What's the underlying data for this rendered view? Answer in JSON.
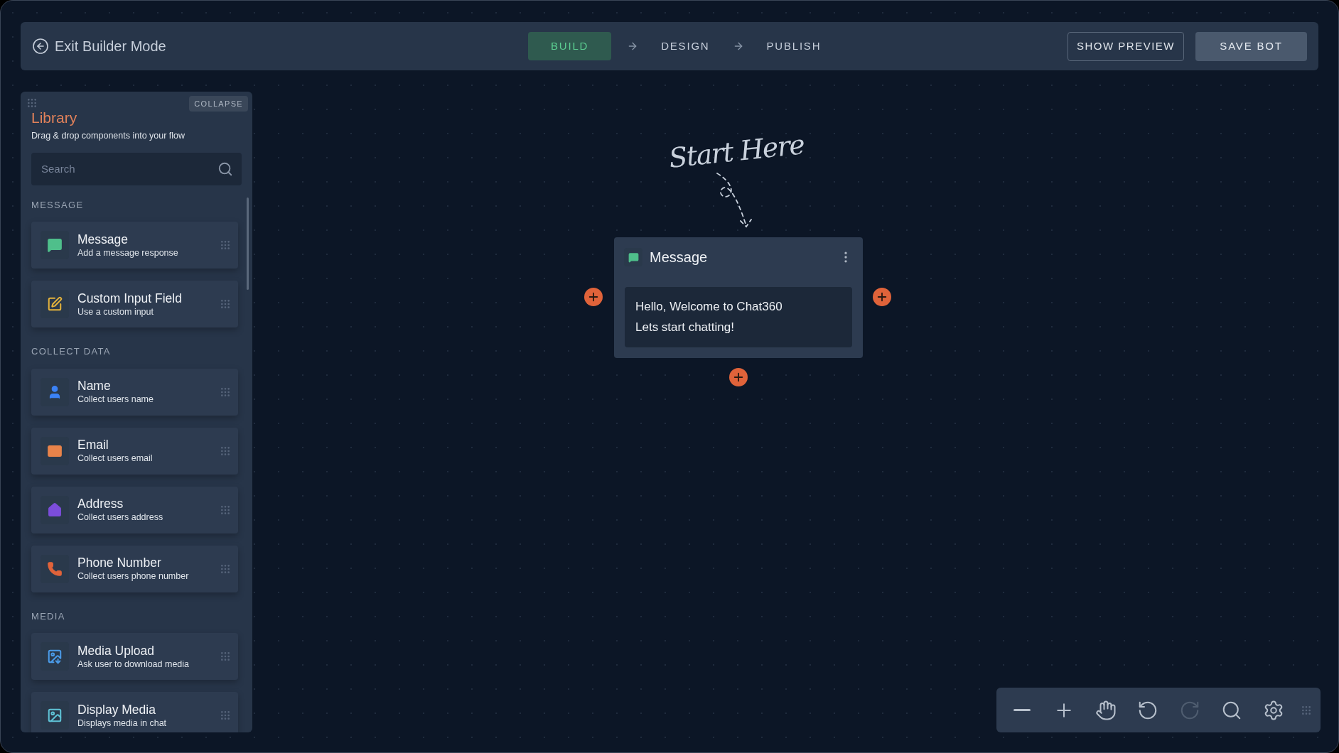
{
  "header": {
    "exit": "Exit Builder Mode",
    "steps": [
      {
        "label": "BUILD",
        "selected": true
      },
      {
        "label": "DESIGN",
        "selected": false
      },
      {
        "label": "PUBLISH",
        "selected": false
      }
    ],
    "buttons": [
      {
        "kind": "outline",
        "label": "SHOW PREVIEW"
      },
      {
        "kind": "solid",
        "label": "SAVE BOT"
      }
    ]
  },
  "library": {
    "collapse": "COLLAPSE",
    "title": "Library",
    "subtitle": "Drag & drop components into your flow",
    "search": {
      "placeholder": "Search"
    },
    "sections": [
      {
        "title": "MESSAGE",
        "items": [
          {
            "kind": "message",
            "title": "Message",
            "description": "Add a message response",
            "color": "#4fbf8b"
          },
          {
            "kind": "input",
            "title": "Custom Input Field",
            "description": "Use a custom input",
            "color": "#e3b23c"
          }
        ]
      },
      {
        "title": "COLLECT DATA",
        "items": [
          {
            "kind": "name",
            "title": "Name",
            "description": "Collect users name",
            "color": "#3b82f6"
          },
          {
            "kind": "email",
            "title": "Email",
            "description": "Collect users email",
            "color": "#e8834a"
          },
          {
            "kind": "address",
            "title": "Address",
            "description": "Collect users address",
            "color": "#7c4ddb"
          },
          {
            "kind": "phone",
            "title": "Phone Number",
            "description": "Collect users phone number",
            "color": "#e0633a"
          }
        ]
      },
      {
        "title": "MEDIA",
        "items": [
          {
            "kind": "upload",
            "title": "Media Upload",
            "description": "Ask user to download media",
            "color": "#4a9be8"
          },
          {
            "kind": "media",
            "title": "Display Media",
            "description": "Displays media in chat",
            "color": "#5fc3d6"
          }
        ]
      }
    ]
  },
  "canvas": {
    "hint": "Start Here",
    "node": {
      "title": "Message",
      "lines": [
        "Hello, Welcome to Chat360",
        "Lets start chatting!"
      ]
    }
  },
  "toolbar": [
    {
      "kind": "zoom-out",
      "disabled": false
    },
    {
      "kind": "zoom-in",
      "disabled": false
    },
    {
      "kind": "pan",
      "disabled": false
    },
    {
      "kind": "undo",
      "disabled": false
    },
    {
      "kind": "redo",
      "disabled": true
    },
    {
      "kind": "search",
      "disabled": false
    },
    {
      "kind": "settings",
      "disabled": false
    }
  ]
}
